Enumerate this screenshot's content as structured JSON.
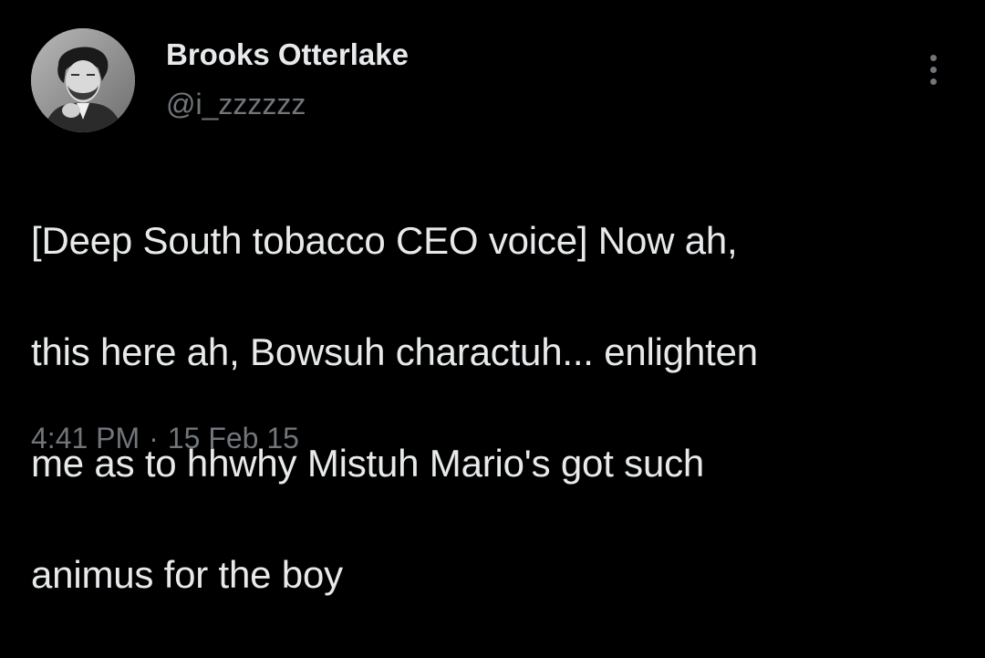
{
  "tweet": {
    "author": {
      "display_name": "Brooks Otterlake",
      "handle": "@i_zzzzzz",
      "avatar_icon": "profile-photo"
    },
    "more_icon": "more-vertical-icon",
    "text_lines": [
      "[Deep South tobacco CEO voice] Now ah,",
      "this here ah, Bowsuh charactuh... enlighten",
      "me as to hhwhy Mistuh Mario's got such",
      "animus for the boy"
    ],
    "time": "4:41 PM",
    "separator": "·",
    "date": "15 Feb 15"
  },
  "colors": {
    "background": "#000000",
    "primary_text": "#e7e9ea",
    "secondary_text": "#71767b"
  }
}
